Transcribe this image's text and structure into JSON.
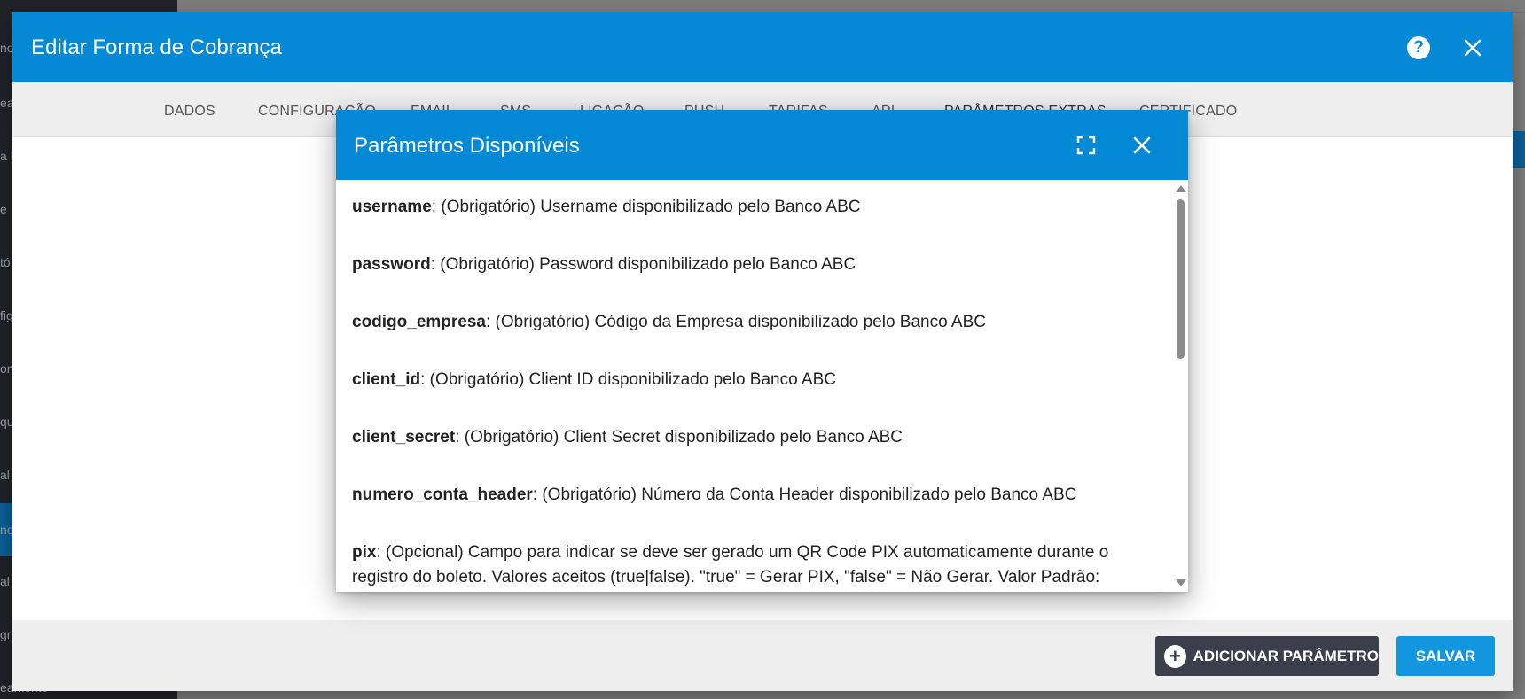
{
  "background": {
    "sidebar_fragments": [
      "no",
      "ea",
      "a F",
      "e",
      "tó",
      "fig",
      "om",
      "qu",
      "al",
      "no",
      "al",
      "gr",
      "eamento"
    ]
  },
  "dialog": {
    "title": "Editar Forma de Cobrança",
    "tabs": [
      {
        "label": "DADOS"
      },
      {
        "label": "CONFIGURAÇÃO"
      },
      {
        "label": "EMAIL"
      },
      {
        "label": "SMS"
      },
      {
        "label": "LIGAÇÃO"
      },
      {
        "label": "PUSH"
      },
      {
        "label": "TARIFAS"
      },
      {
        "label": "API"
      },
      {
        "label": "PARÂMETROS EXTRAS"
      },
      {
        "label": "CERTIFICADO"
      }
    ],
    "active_tab": "PARÂMETROS EXTRAS",
    "footer": {
      "add_label": "ADICIONAR PARÂMETRO",
      "save_label": "SALVAR"
    }
  },
  "sub_dialog": {
    "title": "Parâmetros Disponíveis",
    "params": [
      {
        "key": "username",
        "desc": ": (Obrigatório) Username disponibilizado pelo Banco ABC"
      },
      {
        "key": "password",
        "desc": ": (Obrigatório) Password disponibilizado pelo Banco ABC"
      },
      {
        "key": "codigo_empresa",
        "desc": ": (Obrigatório) Código da Empresa disponibilizado pelo Banco ABC"
      },
      {
        "key": "client_id",
        "desc": ": (Obrigatório) Client ID disponibilizado pelo Banco ABC"
      },
      {
        "key": "client_secret",
        "desc": ": (Obrigatório) Client Secret disponibilizado pelo Banco ABC"
      },
      {
        "key": "numero_conta_header",
        "desc": ": (Obrigatório) Número da Conta Header disponibilizado pelo Banco ABC"
      },
      {
        "key": "pix",
        "desc": ": (Opcional) Campo para indicar se deve ser gerado um QR Code PIX automaticamente durante o registro do boleto. Valores aceitos (true|false). \"true\" = Gerar PIX, \"false\" = Não Gerar. Valor Padrão:"
      }
    ]
  },
  "colors": {
    "header_blue": "#0389d6",
    "save_blue": "#1396e0",
    "add_dark": "#3a3f4b"
  }
}
